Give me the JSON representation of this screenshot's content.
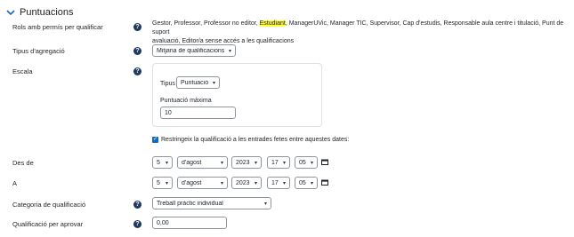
{
  "section": {
    "title": "Puntuacions"
  },
  "roles": {
    "label": "Rols amb permís per qualificar",
    "before": "Gestor, Professor, Professor no editor, ",
    "highlight": "Estudiant",
    "after": ", ManagerUVic, Manager TIC, Supervisor, Cap d'estudis, Responsable aula centre i titulació, Punt de suport",
    "line2": "avaluació, Editor/a sense accés a les qualificacions"
  },
  "aggregation": {
    "label": "Tipus d'agregació",
    "value": "Mitjana de qualificacions"
  },
  "scale": {
    "label": "Escala",
    "type_label": "Tipus",
    "type_value": "Puntuació",
    "max_label": "Puntuació màxima",
    "max_value": "10"
  },
  "restrict": {
    "label": "Restringeix la qualificació a les entrades fetes entre aquestes dates:"
  },
  "from": {
    "label": "Des de",
    "day": "5",
    "month": "d'agost",
    "year": "2023",
    "hour": "17",
    "minute": "05"
  },
  "to": {
    "label": "A",
    "day": "5",
    "month": "d'agost",
    "year": "2023",
    "hour": "17",
    "minute": "05"
  },
  "category": {
    "label": "Categoria de qualificació",
    "value": "Treball pràctic individual"
  },
  "pass": {
    "label": "Qualificació per aprovar",
    "value": "0,00"
  },
  "icons": {
    "help": "?",
    "help_icon": "question-circle-icon",
    "calendar": "calendar-icon",
    "collapse": "chevron-down-icon"
  },
  "colors": {
    "accent": "#0f6cbf",
    "help": "#1e3a5f",
    "highlight": "#ffff3b"
  }
}
